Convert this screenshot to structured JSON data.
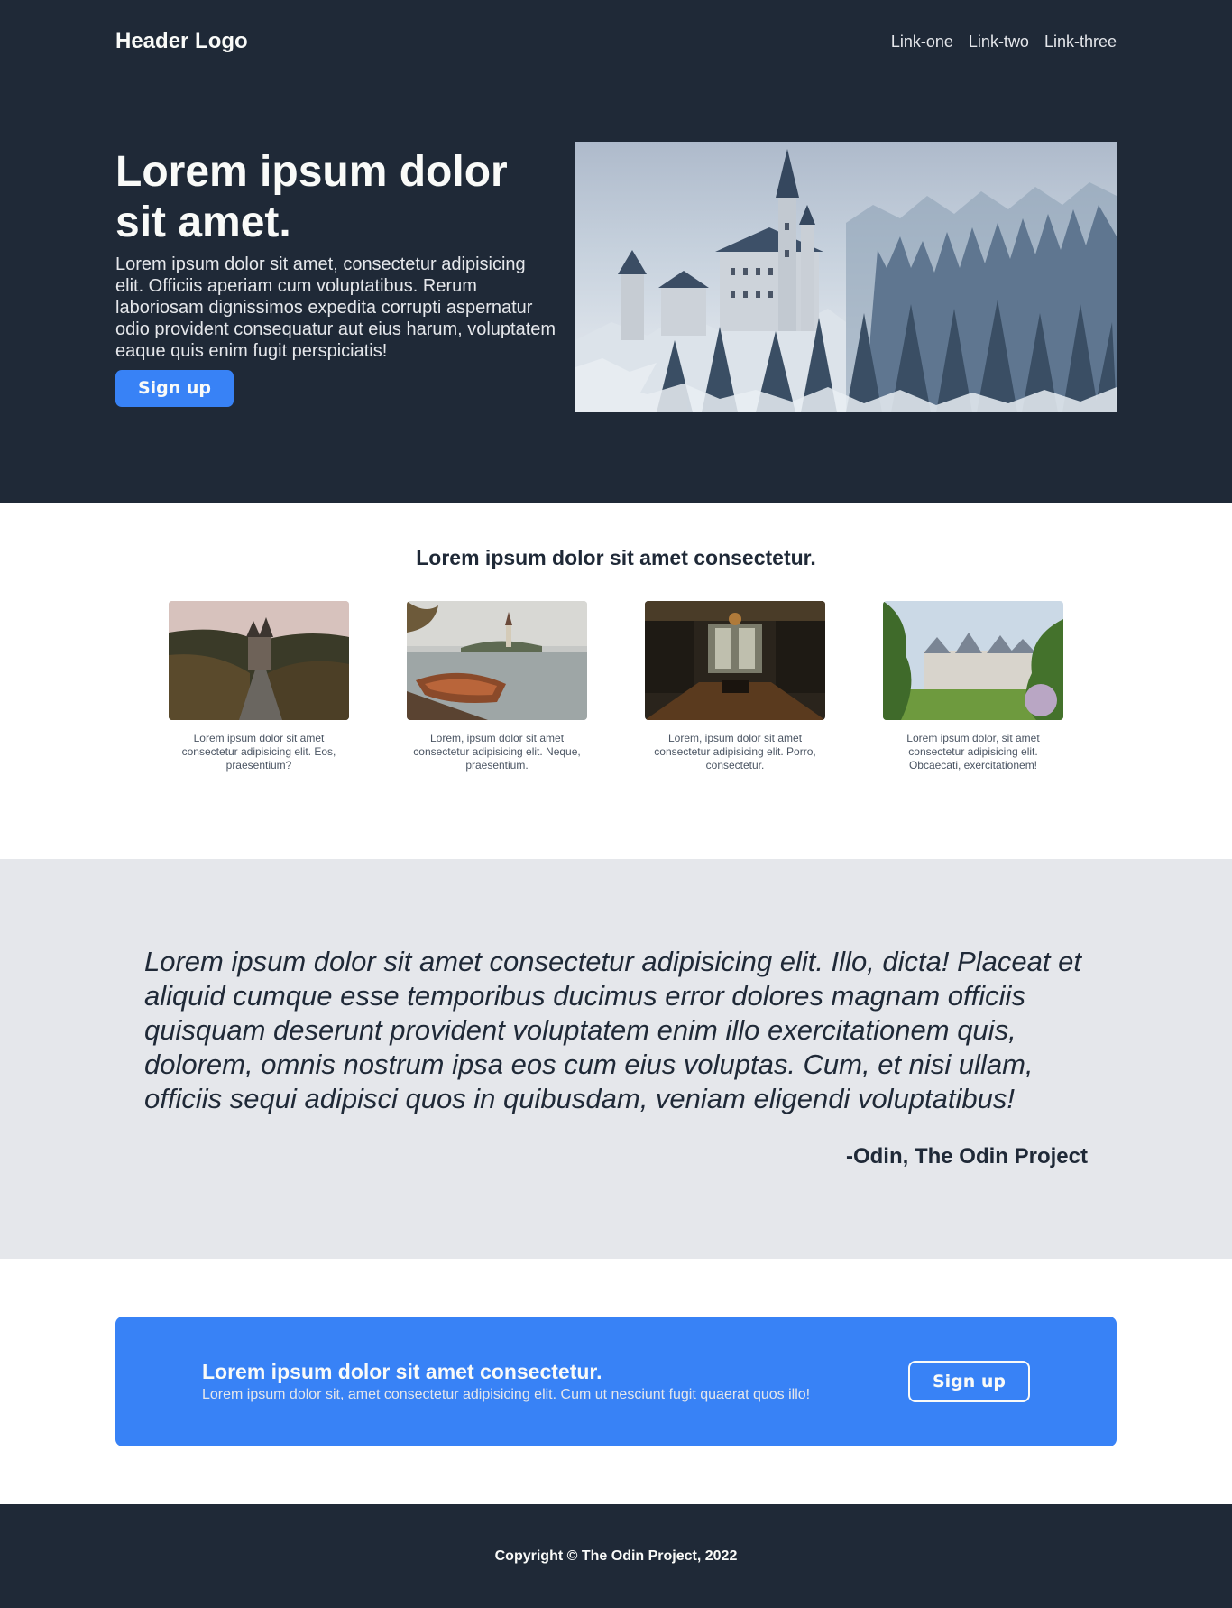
{
  "header": {
    "logo": "Header Logo",
    "links": [
      "Link-one",
      "Link-two",
      "Link-three"
    ]
  },
  "hero": {
    "title": "Lorem ipsum dolor sit amet.",
    "body": "Lorem ipsum dolor sit amet, consectetur adipisicing elit. Officiis aperiam cum voluptatibus. Rerum laboriosam dignissimos expedita corrupti aspernatur odio provident consequatur aut eius harum, voluptatem eaque quis enim fugit perspiciatis!",
    "button": "Sign up",
    "image": "snowy-castle-image"
  },
  "info": {
    "title": "Lorem ipsum dolor sit amet consectetur.",
    "cards": [
      {
        "image": "castle-road-image",
        "text": "Lorem ipsum dolor sit amet consectetur adipisicing elit. Eos, praesentium?"
      },
      {
        "image": "lake-boat-image",
        "text": "Lorem, ipsum dolor sit amet consectetur adipisicing elit. Neque, praesentium."
      },
      {
        "image": "interior-hall-image",
        "text": "Lorem, ipsum dolor sit amet consectetur adipisicing elit. Porro, consectetur."
      },
      {
        "image": "chateau-image",
        "text": "Lorem ipsum dolor, sit amet consectetur adipisicing elit. Obcaecati, exercitationem!"
      }
    ]
  },
  "quote": {
    "text": "Lorem ipsum dolor sit amet consectetur adipisicing elit. Illo, dicta! Placeat et aliquid cumque esse temporibus ducimus error dolores magnam officiis quisquam deserunt provident voluptatem enim illo exercitationem quis, dolorem, omnis nostrum ipsa eos cum eius voluptas. Cum, et nisi ullam, officiis sequi adipisci quos in quibusdam, veniam eligendi voluptatibus!",
    "author": "-Odin, The Odin Project"
  },
  "cta": {
    "title": "Lorem ipsum dolor sit amet consectetur.",
    "body": "Lorem ipsum dolor sit, amet consectetur adipisicing elit. Cum ut nesciunt fugit quaerat quos illo!",
    "button": "Sign up"
  },
  "footer": {
    "text": "Copyright © The Odin Project, 2022"
  },
  "colors": {
    "dark": "#1f2937",
    "accent": "#3882f6",
    "light_gray": "#e5e7eb",
    "text_light": "#f9faf8"
  }
}
